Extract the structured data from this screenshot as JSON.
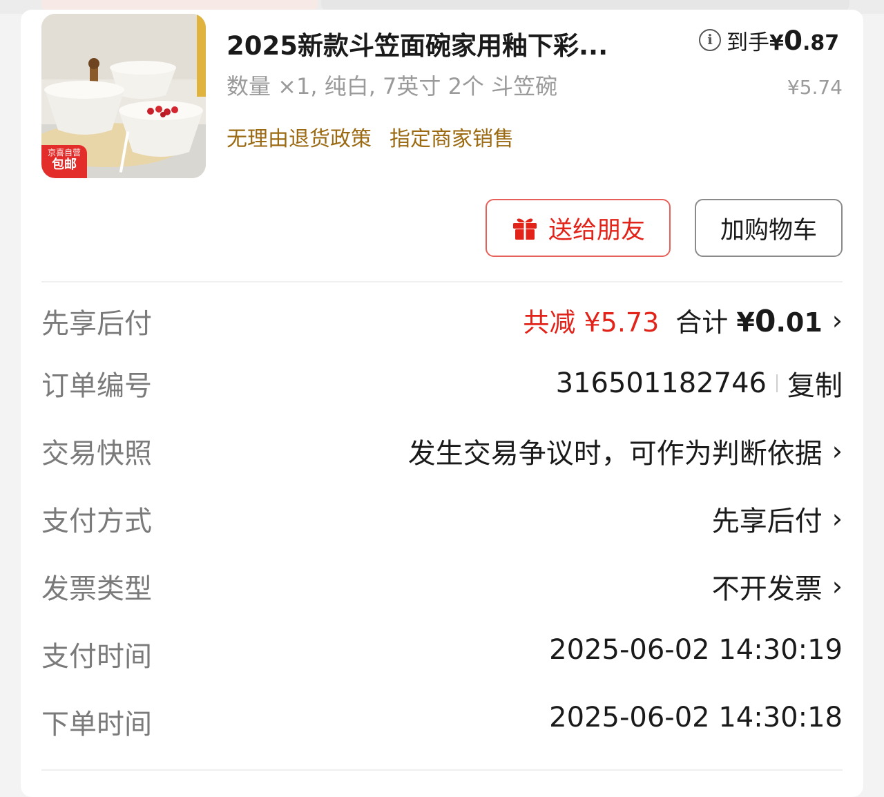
{
  "product": {
    "title": "2025新款斗笠面碗家用釉下彩...",
    "final_price_label": "到手",
    "final_price_currency": "¥",
    "final_price_int": "0",
    "final_price_dec": ".87",
    "spec": "数量 ×1, 纯白, 7英寸 2个 斗笠碗",
    "original_price": "¥5.74",
    "badge_top": "京喜自营",
    "badge_bottom": "包邮",
    "tags": [
      "无理由退货政策",
      "指定商家销售"
    ]
  },
  "actions": {
    "gift_label": "送给朋友",
    "cart_label": "加购物车"
  },
  "details": {
    "payment_row": {
      "label": "先享后付",
      "discount": "共减 ¥5.73",
      "total_label": "合计 ",
      "total_currency": "¥",
      "total_int": "0",
      "total_dec": ".01"
    },
    "order_no": {
      "label": "订单编号",
      "value": "316501182746",
      "copy_label": "复制"
    },
    "snapshot": {
      "label": "交易快照",
      "value": "发生交易争议时，可作为判断依据"
    },
    "pay_method": {
      "label": "支付方式",
      "value": "先享后付"
    },
    "invoice": {
      "label": "发票类型",
      "value": "不开发票"
    },
    "pay_time": {
      "label": "支付时间",
      "value": "2025-06-02 14:30:19"
    },
    "order_time": {
      "label": "下单时间",
      "value": "2025-06-02 14:30:18"
    }
  },
  "colors": {
    "accent_red": "#e2231a",
    "tag_gold": "#9b6a12",
    "muted_text": "#7a7a7a"
  }
}
